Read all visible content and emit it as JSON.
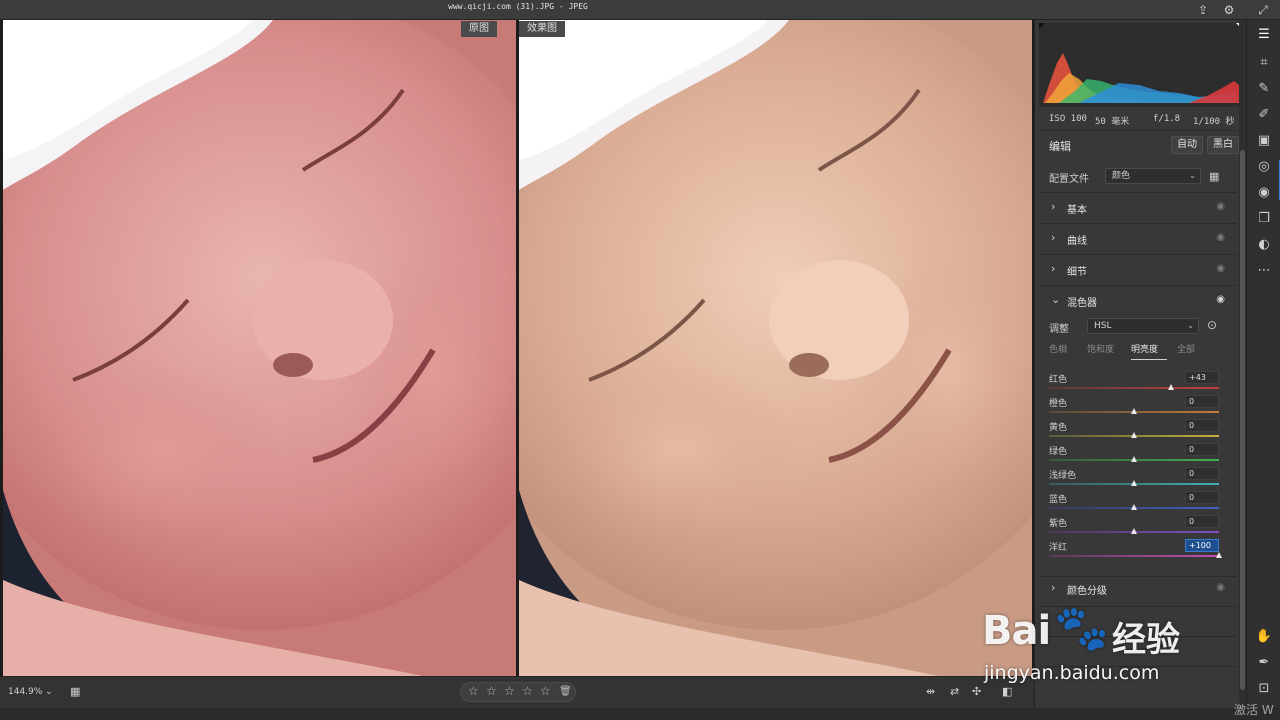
{
  "window": {
    "title": "www.qicji.com (31).JPG - JPEG"
  },
  "viewer": {
    "before_label": "原图",
    "after_label": "效果图"
  },
  "bottombar": {
    "zoom": "144.9% ⌄",
    "rating_stars": 0
  },
  "histogram": {
    "exif": {
      "iso": "ISO 100",
      "focal": "50 毫米",
      "aperture": "f/1.8",
      "shutter": "1/100 秒"
    }
  },
  "edit": {
    "title": "编辑",
    "auto_label": "自动",
    "bw_label": "黑白",
    "profile_label": "配置文件",
    "profile_value": "颜色"
  },
  "sections": {
    "basic": "基本",
    "curve": "曲线",
    "detail": "细节",
    "mixer": "混色器",
    "color_grading": "颜色分级"
  },
  "mixer": {
    "adjust_label": "调整",
    "adjust_value": "HSL",
    "tabs": {
      "hue": "色相",
      "saturation": "饱和度",
      "luminance": "明亮度",
      "all": "全部"
    },
    "sliders": [
      {
        "name": "红色",
        "value": "+43",
        "level": 43
      },
      {
        "name": "橙色",
        "value": "0",
        "level": 0
      },
      {
        "name": "黄色",
        "value": "0",
        "level": 0
      },
      {
        "name": "绿色",
        "value": "0",
        "level": 0
      },
      {
        "name": "浅绿色",
        "value": "0",
        "level": 0
      },
      {
        "name": "蓝色",
        "value": "0",
        "level": 0
      },
      {
        "name": "紫色",
        "value": "0",
        "level": 0
      },
      {
        "name": "洋红",
        "value": "+100",
        "level": 100
      }
    ]
  },
  "watermark": {
    "logo_latin": "Bai",
    "logo_cn": "经验",
    "url": "jingyan.baidu.com",
    "corner": "激活 W"
  },
  "colors": {
    "accent": "#3a7bd5",
    "panel_bg": "#383838",
    "viewer_bg": "#1c1c1c"
  }
}
